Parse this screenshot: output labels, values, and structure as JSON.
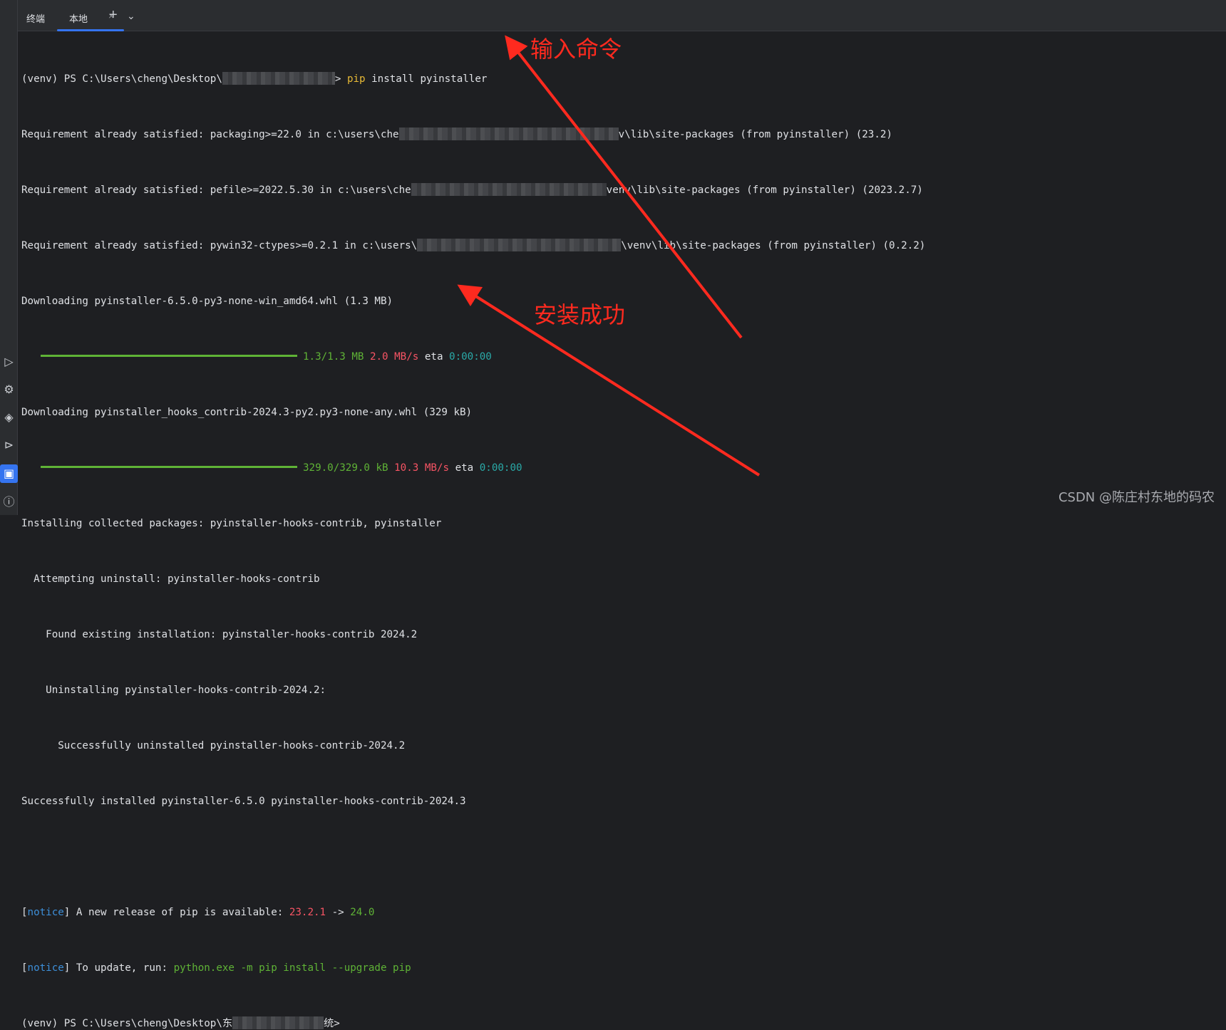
{
  "tabs": {
    "title": "终端",
    "local_label": "本地",
    "close_glyph": "×",
    "add_glyph": "+",
    "dropdown_glyph": "⌄"
  },
  "terminal": {
    "prompt1_pre": "(venv) PS C:\\Users\\cheng\\Desktop\\",
    "prompt1_post": "> ",
    "command_pip": "pip",
    "command_rest": " install pyinstaller",
    "req1_pre": "Requirement already satisfied: packaging>=22.0 in c:\\users\\che",
    "req1_post": "v\\lib\\site-packages (from pyinstaller) (23.2)",
    "req2_pre": "Requirement already satisfied: pefile>=2022.5.30 in c:\\users\\che",
    "req2_post": "venv\\lib\\site-packages (from pyinstaller) (2023.2.7)",
    "req3_pre": "Requirement already satisfied: pywin32-ctypes>=0.2.1 in c:\\users\\",
    "req3_post": "\\venv\\lib\\site-packages (from pyinstaller) (0.2.2)",
    "dl1": "Downloading pyinstaller-6.5.0-py3-none-win_amd64.whl (1.3 MB)",
    "dl1_size": "1.3/1.3 MB",
    "dl1_speed": "2.0 MB/s",
    "dl1_eta_label": "eta",
    "dl1_eta": "0:00:00",
    "dl2": "Downloading pyinstaller_hooks_contrib-2024.3-py2.py3-none-any.whl (329 kB)",
    "dl2_size": "329.0/329.0 kB",
    "dl2_speed": "10.3 MB/s",
    "dl2_eta_label": "eta",
    "dl2_eta": "0:00:00",
    "install1": "Installing collected packages: pyinstaller-hooks-contrib, pyinstaller",
    "install2": "  Attempting uninstall: pyinstaller-hooks-contrib",
    "install3": "    Found existing installation: pyinstaller-hooks-contrib 2024.2",
    "install4": "    Uninstalling pyinstaller-hooks-contrib-2024.2:",
    "install5": "      Successfully uninstalled pyinstaller-hooks-contrib-2024.2",
    "success": "Successfully installed pyinstaller-6.5.0 pyinstaller-hooks-contrib-2024.3",
    "notice_word": "notice",
    "notice1_text": " A new release of pip is available: ",
    "notice1_old": "23.2.1",
    "notice1_arrow": " -> ",
    "notice1_new": "24.0",
    "notice2_text": " To update, run: ",
    "notice2_cmd": "python.exe -m pip install --upgrade pip",
    "prompt2_pre": "(venv) PS C:\\Users\\cheng\\Desktop\\",
    "prompt2_char1": "东",
    "prompt2_char2": "统",
    "prompt2_post": ">",
    "bracket_open": "[",
    "bracket_close": "]"
  },
  "annotations": {
    "input_command": "输入命令",
    "install_success": "安装成功",
    "arrow_color": "#ff2a1f"
  },
  "watermark": "CSDN @陈庄村东地的码农",
  "sidebar_icons": [
    "run-icon",
    "python-console-icon",
    "layers-icon",
    "services-icon",
    "terminal-icon",
    "problems-icon"
  ]
}
